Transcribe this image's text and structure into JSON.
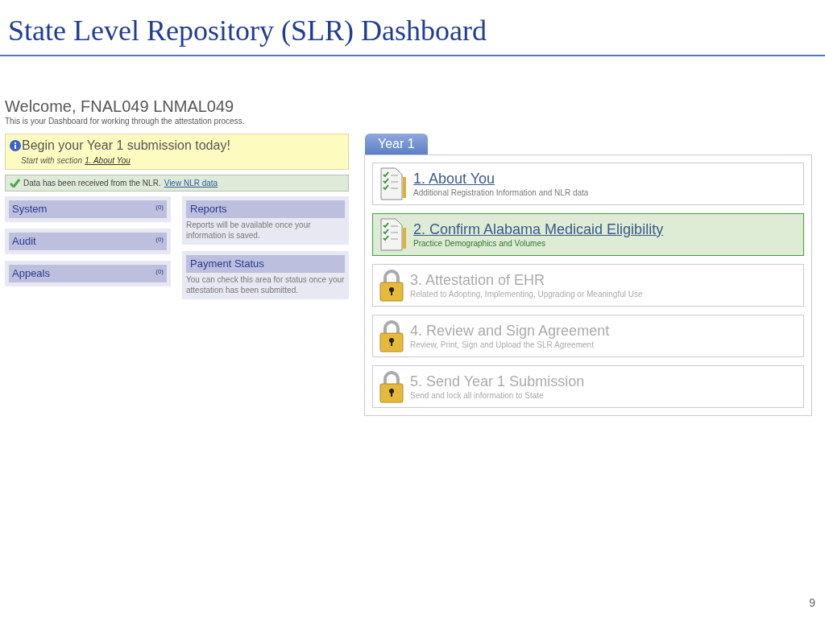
{
  "slide": {
    "title": "State Level Repository (SLR) Dashboard",
    "page_number": "9"
  },
  "welcome": {
    "heading": "Welcome, FNAL049 LNMAL049",
    "subtitle": "This is your Dashboard for working through the attestation process."
  },
  "notice": {
    "heading": "Begin your Year 1 submission today!",
    "prefix": "Start with section",
    "link": "1. About You"
  },
  "status_message": {
    "text": "Data has been received from the NLR.",
    "link": "View NLR data"
  },
  "counters": [
    {
      "label": "System",
      "count": "(0)"
    },
    {
      "label": "Audit",
      "count": "(0)"
    },
    {
      "label": "Appeals",
      "count": "(0)"
    }
  ],
  "info_panels": [
    {
      "title": "Reports",
      "text": "Reports will be available once your information is saved."
    },
    {
      "title": "Payment Status",
      "text": "You can check this area for status once your attestation has been submitted."
    }
  ],
  "tabs": [
    {
      "label": "Year 1",
      "selected": true
    }
  ],
  "sections": [
    {
      "kind": "open",
      "selected": false,
      "title": "1. About You",
      "subtitle": "Additional Registration Information and NLR data"
    },
    {
      "kind": "open",
      "selected": true,
      "title": "2. Confirm Alabama Medicaid Eligibility",
      "subtitle": "Practice Demographics and Volumes"
    },
    {
      "kind": "locked",
      "selected": false,
      "title": "3. Attestation of EHR",
      "subtitle": "Related to Adopting, Implementing, Upgrading or Meaningful Use"
    },
    {
      "kind": "locked",
      "selected": false,
      "title": "4. Review and Sign Agreement",
      "subtitle": "Review, Print, Sign and Upload the SLR Agreement"
    },
    {
      "kind": "locked",
      "selected": false,
      "title": "5. Send Year 1 Submission",
      "subtitle": "Send and lock all information to State"
    }
  ]
}
